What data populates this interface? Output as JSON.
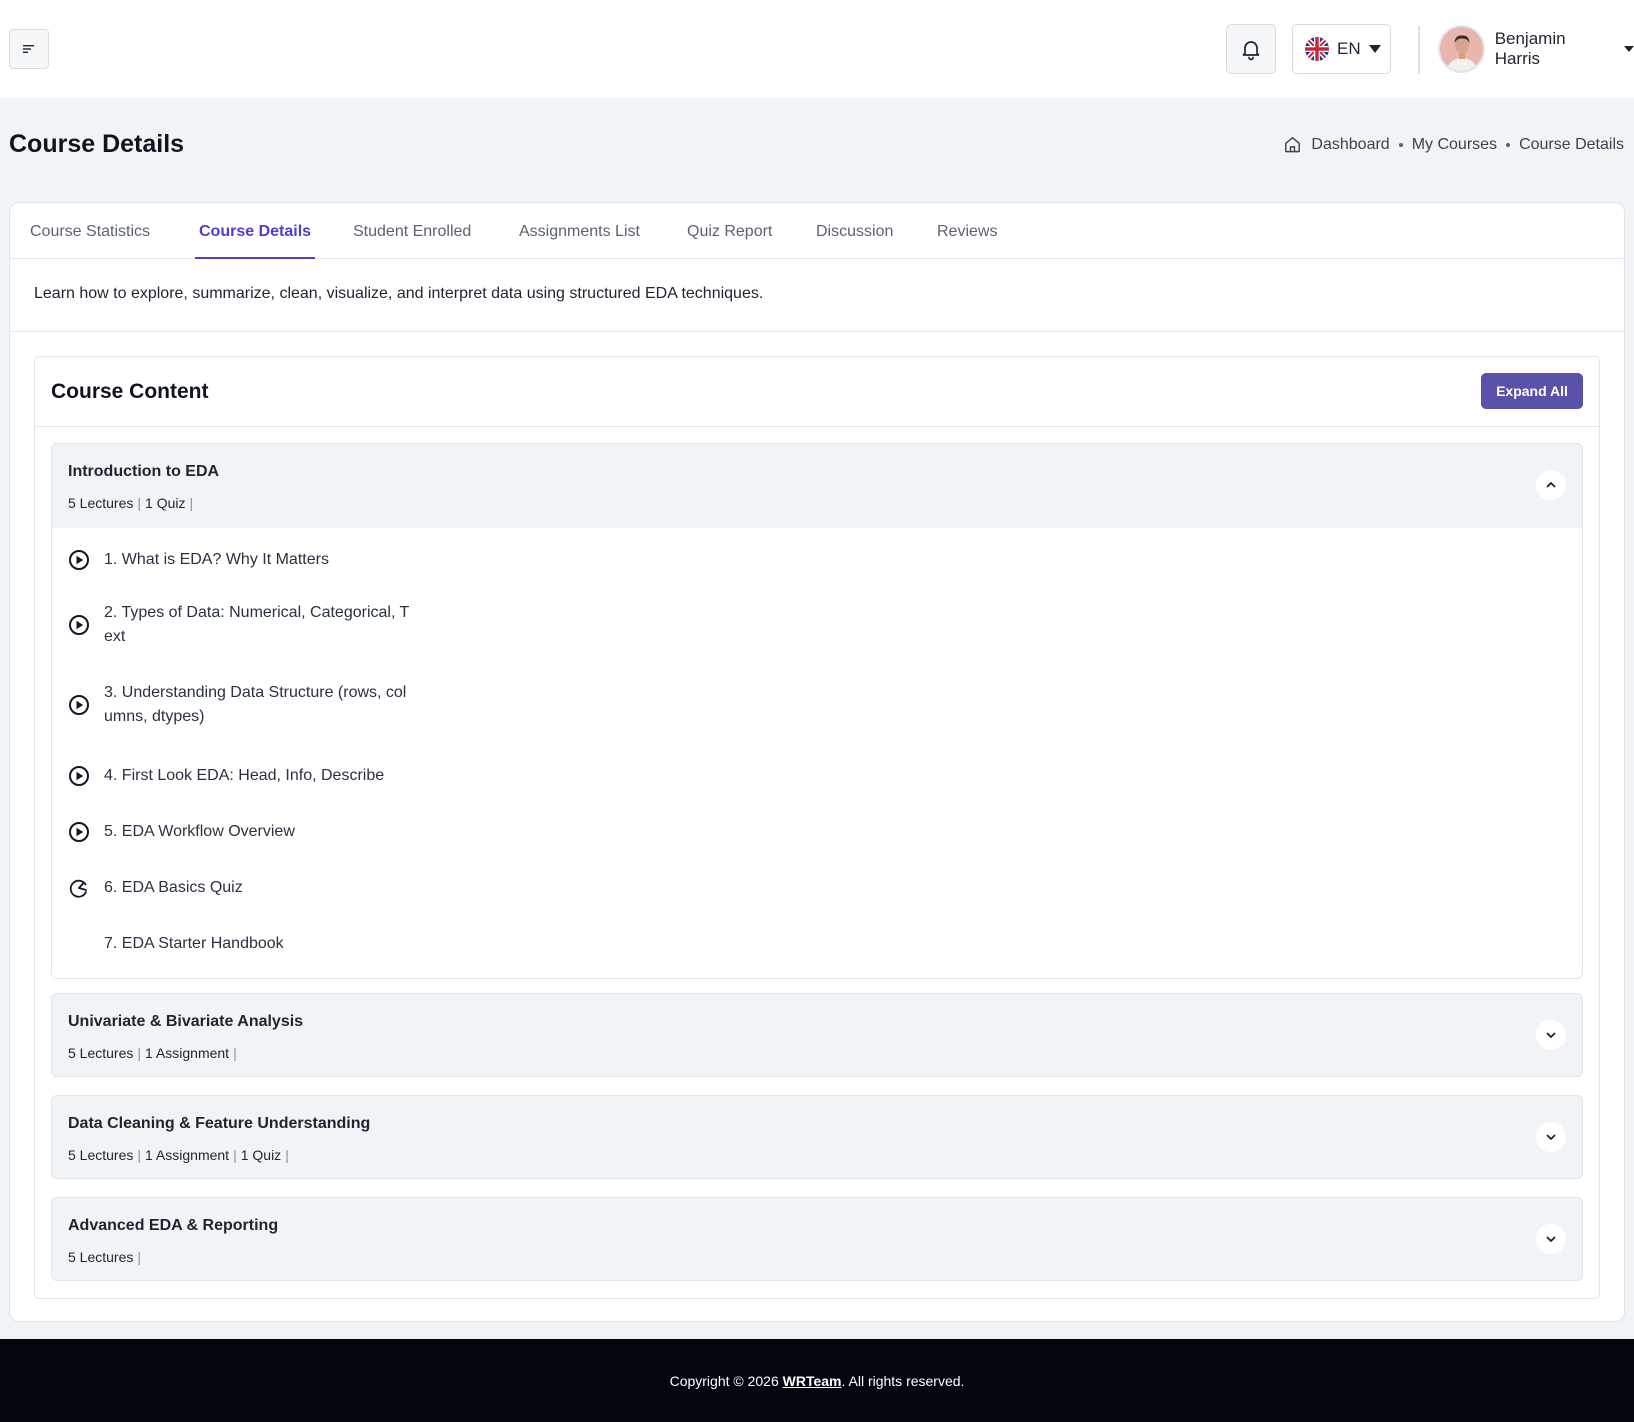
{
  "header": {
    "language": "EN",
    "user_name": "Benjamin Harris"
  },
  "page": {
    "title": "Course Details",
    "breadcrumb": [
      "Dashboard",
      "My Courses",
      "Course Details"
    ]
  },
  "tabs": [
    {
      "label": "Course Statistics",
      "active": false
    },
    {
      "label": "Course Details",
      "active": true
    },
    {
      "label": "Student Enrolled",
      "active": false
    },
    {
      "label": "Assignments List",
      "active": false
    },
    {
      "label": "Quiz Report",
      "active": false
    },
    {
      "label": "Discussion",
      "active": false
    },
    {
      "label": "Reviews",
      "active": false
    }
  ],
  "description": "Learn how to explore, summarize, clean, visualize, and interpret data using structured EDA techniques.",
  "course_content": {
    "title": "Course Content",
    "expand_label": "Expand All",
    "sections": [
      {
        "title": "Introduction to EDA",
        "meta": [
          "5 Lectures",
          "1 Quiz"
        ],
        "expanded": true,
        "lessons": [
          {
            "title": "1. What is EDA? Why It Matters",
            "icon": "play-circle-icon"
          },
          {
            "title": "2. Types of Data: Numerical, Categorical, Text",
            "icon": "play-circle-icon"
          },
          {
            "title": "3. Understanding Data Structure (rows, columns, dtypes)",
            "icon": "play-circle-icon"
          },
          {
            "title": "4. First Look EDA: Head, Info, Describe",
            "icon": "play-circle-icon"
          },
          {
            "title": "5. EDA Workflow Overview",
            "icon": "play-circle-icon"
          },
          {
            "title": "6. EDA Basics Quiz",
            "icon": "quiz-timer-icon"
          },
          {
            "title": "7. EDA Starter Handbook",
            "icon": ""
          }
        ]
      },
      {
        "title": "Univariate & Bivariate Analysis",
        "meta": [
          "5 Lectures",
          "1 Assignment"
        ],
        "expanded": false
      },
      {
        "title": "Data Cleaning & Feature Understanding",
        "meta": [
          "5 Lectures",
          "1 Assignment",
          "1 Quiz"
        ],
        "expanded": false
      },
      {
        "title": "Advanced EDA & Reporting",
        "meta": [
          "5 Lectures"
        ],
        "expanded": false
      }
    ]
  },
  "footer": {
    "prefix": "Copyright © 2026 ",
    "link": "WRTeam",
    "suffix": ". All rights reserved."
  },
  "colors": {
    "accent": "#4d3fd0",
    "button": "#5a52a8",
    "footer_bg": "#04060f"
  }
}
